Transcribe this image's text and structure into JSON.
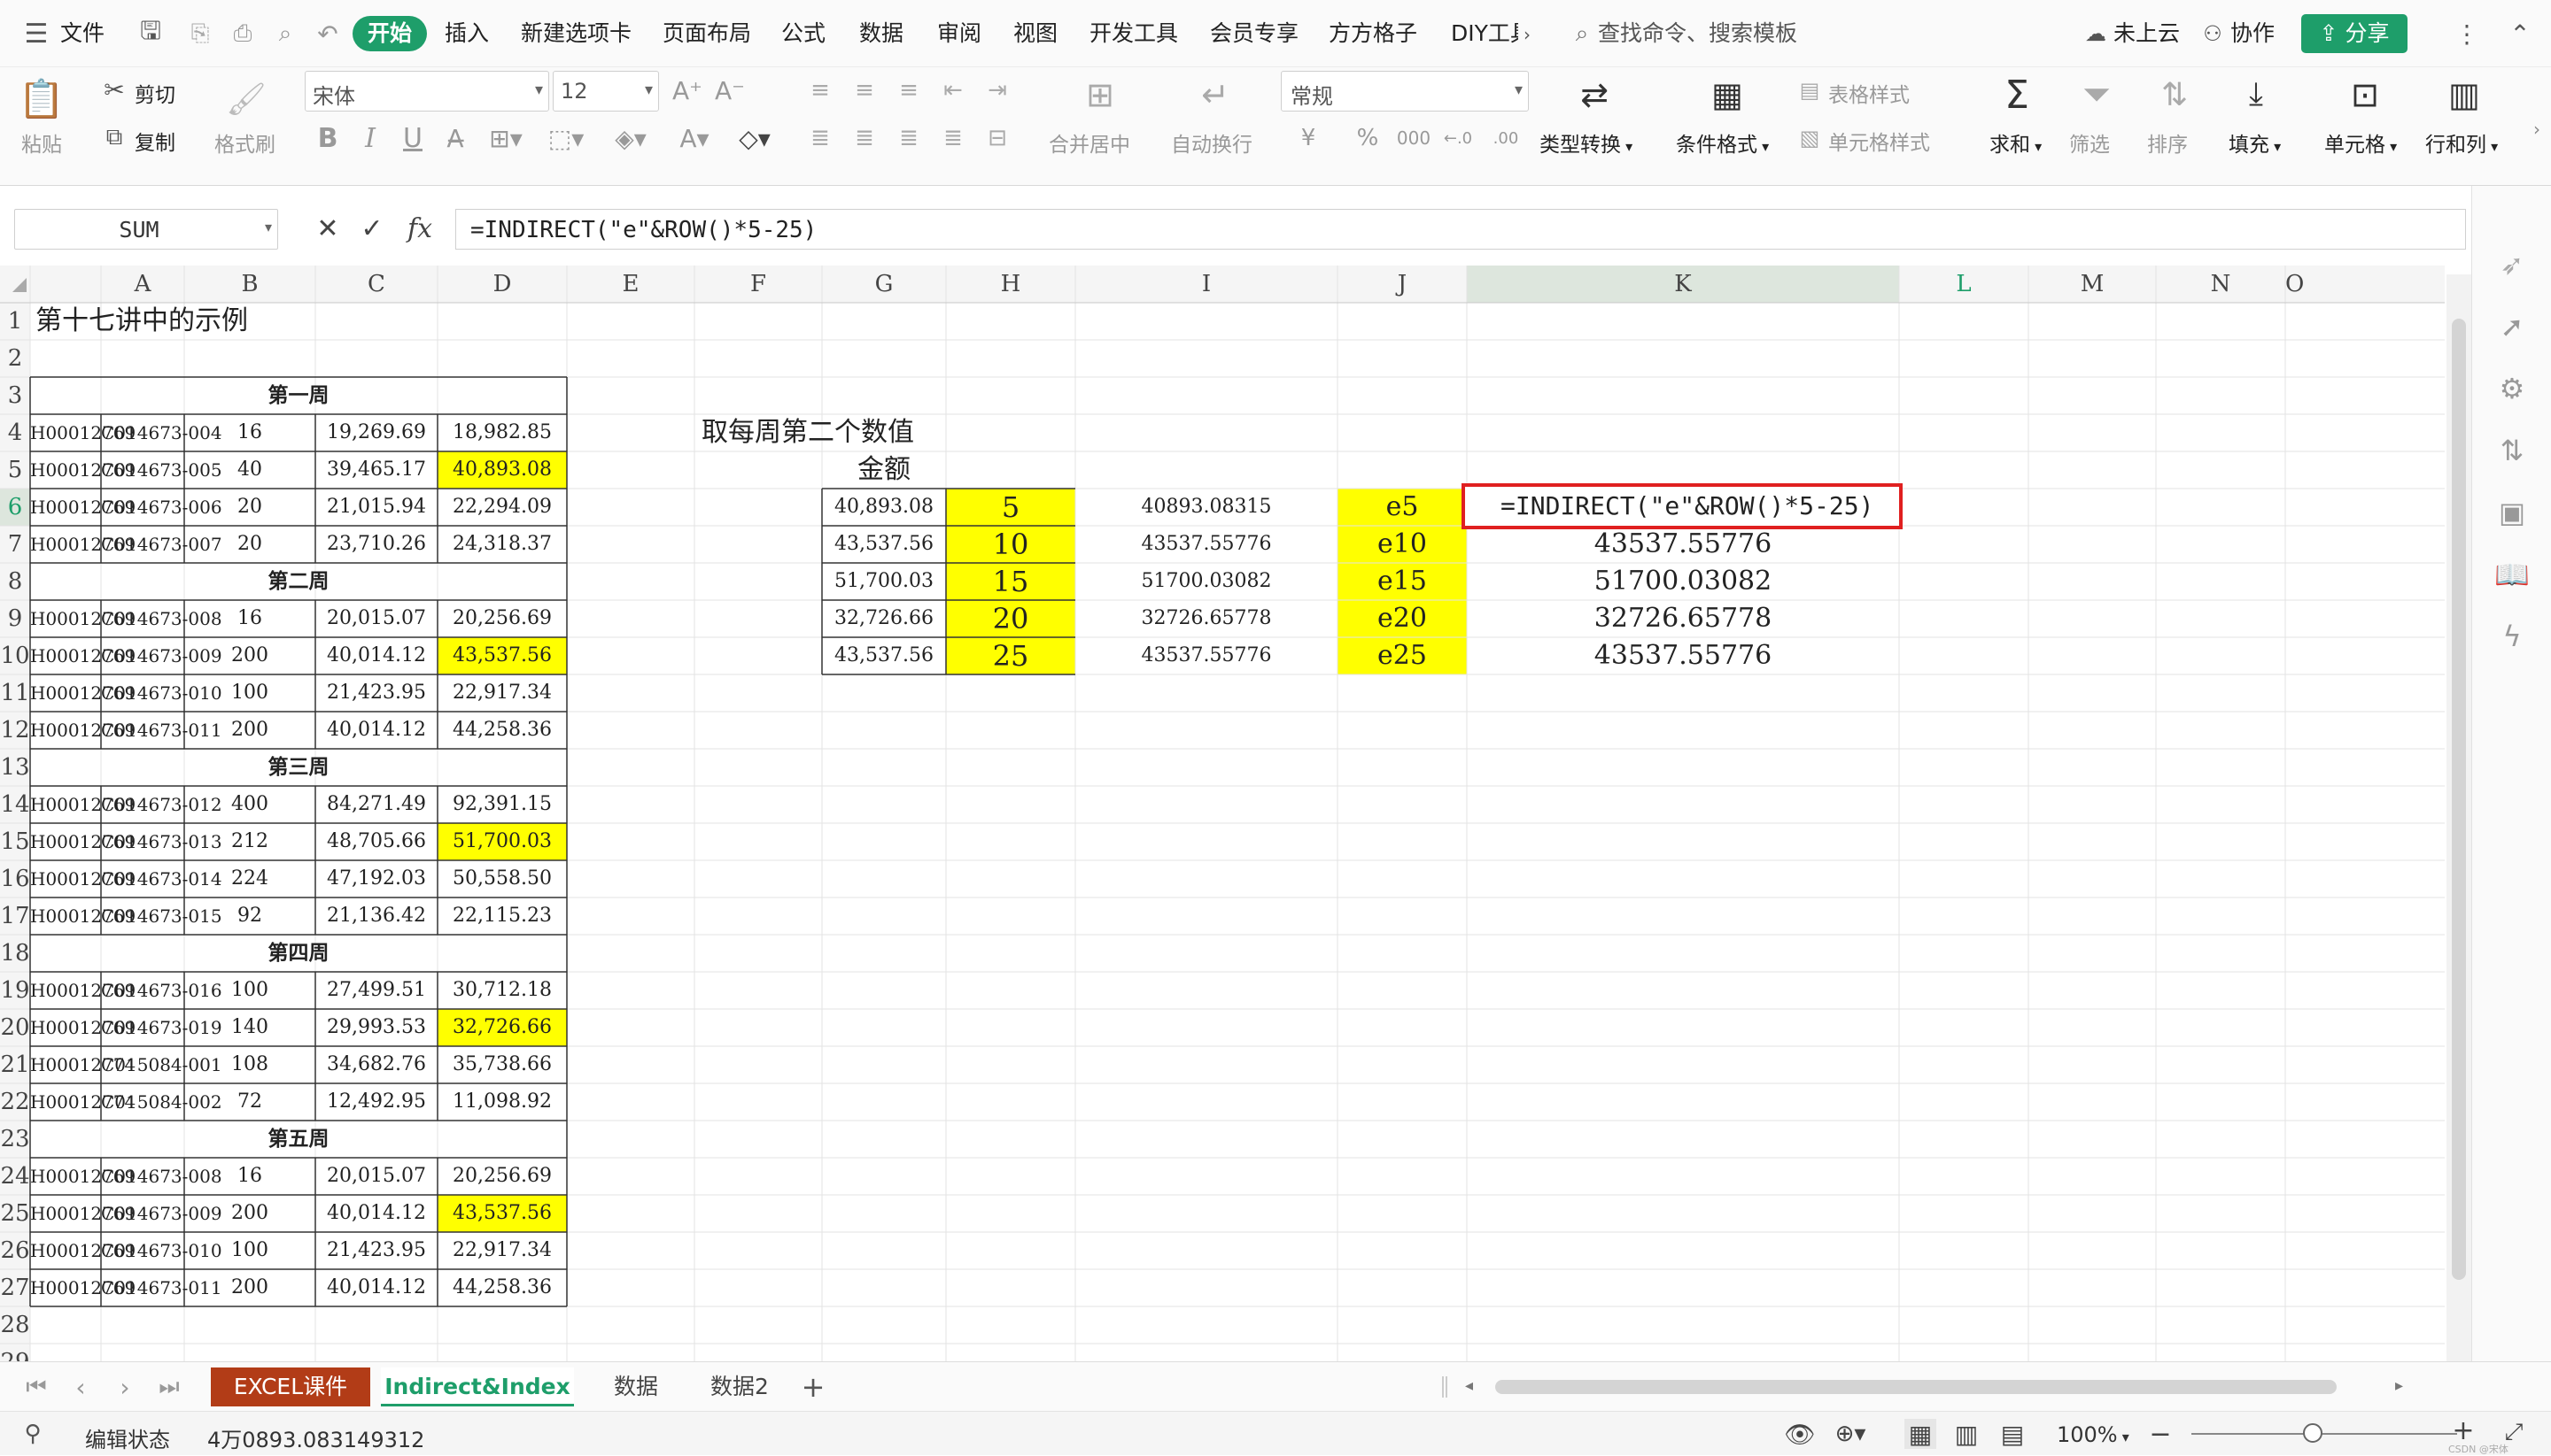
{
  "menu": {
    "file": "文件",
    "tabs": [
      "开始",
      "插入",
      "新建选项卡",
      "页面布局",
      "公式",
      "数据",
      "审阅",
      "视图",
      "开发工具",
      "会员专享",
      "方方格子",
      "DIY工具"
    ],
    "search_placeholder": "查找命令、搜索模板",
    "cloud": "未上云",
    "collab": "协作",
    "share": "分享"
  },
  "ribbon": {
    "paste": "粘贴",
    "cut": "剪切",
    "copy": "复制",
    "format_painter": "格式刷",
    "font_name": "宋体",
    "font_size": "12",
    "merge": "合并居中",
    "wrap": "自动换行",
    "number_format": "常规",
    "type_convert": "类型转换",
    "cond_format": "条件格式",
    "table_style": "表格样式",
    "cell_style": "单元格样式",
    "sum": "求和",
    "filter": "筛选",
    "sort": "排序",
    "fill": "填充",
    "cell": "单元格",
    "rowcol": "行和列",
    "bold": "B",
    "italic": "I",
    "underline": "U",
    "percent": "%",
    "thousand": "000",
    "currency": "¥"
  },
  "formula_bar": {
    "name_box": "SUM",
    "fx": "fx",
    "formula": "=INDIRECT(\"e\"&ROW()*5-25)"
  },
  "columns": [
    "A",
    "B",
    "C",
    "D",
    "E",
    "F",
    "G",
    "H",
    "I",
    "J",
    "K",
    "L",
    "M",
    "N",
    "O"
  ],
  "rows": [
    "1",
    "2",
    "3",
    "4",
    "5",
    "6",
    "7",
    "8",
    "9",
    "10",
    "11",
    "12",
    "13",
    "14",
    "15",
    "16",
    "17",
    "18",
    "19",
    "20",
    "21",
    "22",
    "23",
    "24",
    "25",
    "26",
    "27",
    "28",
    "29"
  ],
  "cells": {
    "A1": "第十七讲中的示例",
    "week1": "第一周",
    "week2": "第二周",
    "week3": "第三周",
    "week4": "第四周",
    "week5": "第五周",
    "G4": "取每周第二个数值",
    "H5": "金额",
    "L6": "=INDIRECT(\"e\"&ROW()*5-25)"
  },
  "data_rows": [
    {
      "row": 4,
      "a": "H00012769",
      "b": "C014673-004",
      "c": "16",
      "d": "19,269.69",
      "e": "18,982.85",
      "hl": false
    },
    {
      "row": 5,
      "a": "H00012769",
      "b": "C014673-005",
      "c": "40",
      "d": "39,465.17",
      "e": "40,893.08",
      "hl": true
    },
    {
      "row": 6,
      "a": "H00012769",
      "b": "C014673-006",
      "c": "20",
      "d": "21,015.94",
      "e": "22,294.09",
      "hl": false
    },
    {
      "row": 7,
      "a": "H00012769",
      "b": "C014673-007",
      "c": "20",
      "d": "23,710.26",
      "e": "24,318.37",
      "hl": false
    },
    {
      "row": 9,
      "a": "H00012769",
      "b": "C014673-008",
      "c": "16",
      "d": "20,015.07",
      "e": "20,256.69",
      "hl": false
    },
    {
      "row": 10,
      "a": "H00012769",
      "b": "C014673-009",
      "c": "200",
      "d": "40,014.12",
      "e": "43,537.56",
      "hl": true
    },
    {
      "row": 11,
      "a": "H00012769",
      "b": "C014673-010",
      "c": "100",
      "d": "21,423.95",
      "e": "22,917.34",
      "hl": false
    },
    {
      "row": 12,
      "a": "H00012769",
      "b": "C014673-011",
      "c": "200",
      "d": "40,014.12",
      "e": "44,258.36",
      "hl": false
    },
    {
      "row": 14,
      "a": "H00012769",
      "b": "C014673-012",
      "c": "400",
      "d": "84,271.49",
      "e": "92,391.15",
      "hl": false
    },
    {
      "row": 15,
      "a": "H00012769",
      "b": "C014673-013",
      "c": "212",
      "d": "48,705.66",
      "e": "51,700.03",
      "hl": true
    },
    {
      "row": 16,
      "a": "H00012769",
      "b": "C014673-014",
      "c": "224",
      "d": "47,192.03",
      "e": "50,558.50",
      "hl": false
    },
    {
      "row": 17,
      "a": "H00012769",
      "b": "C014673-015",
      "c": "92",
      "d": "21,136.42",
      "e": "22,115.23",
      "hl": false
    },
    {
      "row": 19,
      "a": "H00012769",
      "b": "C014673-016",
      "c": "100",
      "d": "27,499.51",
      "e": "30,712.18",
      "hl": false
    },
    {
      "row": 20,
      "a": "H00012769",
      "b": "C014673-019",
      "c": "140",
      "d": "29,993.53",
      "e": "32,726.66",
      "hl": true
    },
    {
      "row": 21,
      "a": "H00012774",
      "b": "C015084-001",
      "c": "108",
      "d": "34,682.76",
      "e": "35,738.66",
      "hl": false
    },
    {
      "row": 22,
      "a": "H00012774",
      "b": "C015084-002",
      "c": "72",
      "d": "12,492.95",
      "e": "11,098.92",
      "hl": false
    },
    {
      "row": 24,
      "a": "H00012769",
      "b": "C014673-008",
      "c": "16",
      "d": "20,015.07",
      "e": "20,256.69",
      "hl": false
    },
    {
      "row": 25,
      "a": "H00012769",
      "b": "C014673-009",
      "c": "200",
      "d": "40,014.12",
      "e": "43,537.56",
      "hl": true
    },
    {
      "row": 26,
      "a": "H00012769",
      "b": "C014673-010",
      "c": "100",
      "d": "21,423.95",
      "e": "22,917.34",
      "hl": false
    },
    {
      "row": 27,
      "a": "H00012769",
      "b": "C014673-011",
      "c": "200",
      "d": "40,014.12",
      "e": "44,258.36",
      "hl": false
    }
  ],
  "right_rows": [
    {
      "row": 6,
      "h": "40,893.08",
      "i": "5",
      "j": "40893.08315",
      "k": "e5",
      "l": ""
    },
    {
      "row": 7,
      "h": "43,537.56",
      "i": "10",
      "j": "43537.55776",
      "k": "e10",
      "l": "43537.55776"
    },
    {
      "row": 8,
      "h": "51,700.03",
      "i": "15",
      "j": "51700.03082",
      "k": "e15",
      "l": "51700.03082"
    },
    {
      "row": 9,
      "h": "32,726.66",
      "i": "20",
      "j": "32726.65778",
      "k": "e20",
      "l": "32726.65778"
    },
    {
      "row": 10,
      "h": "43,537.56",
      "i": "25",
      "j": "43537.55776",
      "k": "e25",
      "l": "43537.55776"
    }
  ],
  "sheets": [
    "EXCEL课件",
    "Indirect&Index",
    "数据",
    "数据2"
  ],
  "status": {
    "mode": "编辑状态",
    "value": "4万0893.083149312",
    "zoom": "100%",
    "watermark": "CSDN @宋体"
  },
  "colors": {
    "highlight": "#ffff00",
    "accent": "#1e9e6a",
    "active_tab_bg": "#b23c17",
    "active_sheet_text": "#1e9e6a",
    "selection_border": "#e02020"
  }
}
